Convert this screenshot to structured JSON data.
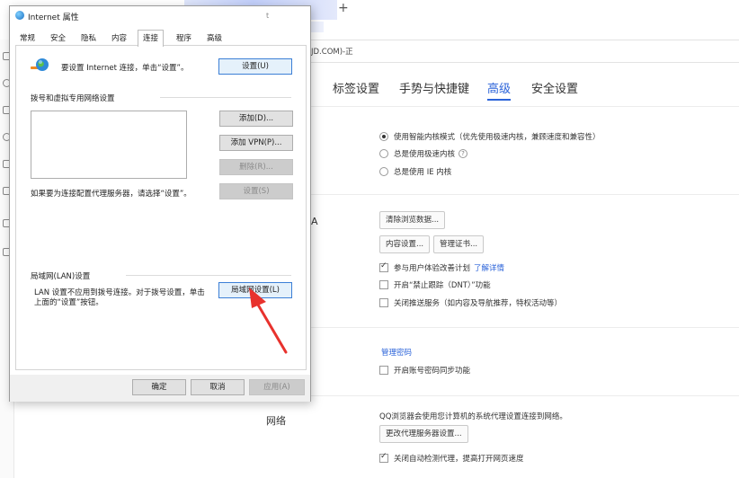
{
  "browser": {
    "new_tab_symbol": "+",
    "address_text": "JD.COM)-正",
    "settings_tabs": [
      {
        "label": "标签设置",
        "active": false
      },
      {
        "label": "手势与快捷键",
        "active": false
      },
      {
        "label": "高级",
        "active": true
      },
      {
        "label": "安全设置",
        "active": false
      }
    ],
    "partial_label_a": "A",
    "core_mode": {
      "options": [
        {
          "label": "使用智能内核模式（优先使用极速内核，兼顾速度和兼容性）",
          "selected": true
        },
        {
          "label": "总是使用极速内核",
          "selected": false,
          "help": "?"
        },
        {
          "label": "总是使用 IE 内核",
          "selected": false
        }
      ]
    },
    "privacy": {
      "clear_button": "清除浏览数据...",
      "content_button": "内容设置...",
      "cert_button": "管理证书...",
      "checkboxes": [
        {
          "label": "参与用户体验改善计划",
          "link": "了解详情",
          "checked": true
        },
        {
          "label": "开启“禁止跟踪（DNT）”功能",
          "checked": false
        },
        {
          "label": "关闭推送服务（如内容及导航推荐，特权活动等）",
          "checked": false
        }
      ]
    },
    "password": {
      "link": "管理密码",
      "sync_label": "开启账号密码同步功能",
      "sync_checked": false
    },
    "network": {
      "heading": "网络",
      "desc": "QQ浏览器会使用您计算机的系统代理设置连接到网络。",
      "proxy_button": "更改代理服务器设置...",
      "auto_detect_label": "关闭自动检测代理，提高打开网页速度",
      "auto_detect_checked": true
    }
  },
  "dialog": {
    "title": "Internet 属性",
    "title_mark": "t",
    "tabs": [
      {
        "label": "常规",
        "active": false
      },
      {
        "label": "安全",
        "active": false
      },
      {
        "label": "隐私",
        "active": false
      },
      {
        "label": "内容",
        "active": false
      },
      {
        "label": "连接",
        "active": true
      },
      {
        "label": "程序",
        "active": false
      },
      {
        "label": "高级",
        "active": false
      }
    ],
    "setup_text": "要设置 Internet 连接，单击“设置”。",
    "setup_button": "设置(U)",
    "dialup_section": "拨号和虚拟专用网络设置",
    "add_button": "添加(D)...",
    "add_vpn_button": "添加 VPN(P)...",
    "remove_button": "删除(R)...",
    "proxy_hint": "如果要为连接配置代理服务器，请选择“设置”。",
    "settings_button": "设置(S)",
    "lan_section": "局域网(LAN)设置",
    "lan_text_1": "LAN 设置不应用到拨号连接。对于拨号设置，单击",
    "lan_text_2": "上面的“设置”按钮。",
    "lan_button": "局域网设置(L)",
    "ok_button": "确定",
    "cancel_button": "取消",
    "apply_button": "应用(A)"
  },
  "colors": {
    "accent": "#2b63d9",
    "annotation_arrow": "#e8322d"
  }
}
